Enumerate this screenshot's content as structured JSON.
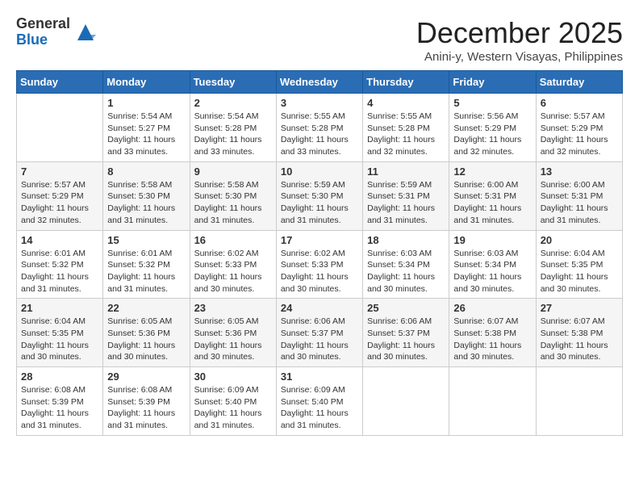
{
  "logo": {
    "general": "General",
    "blue": "Blue"
  },
  "title": "December 2025",
  "location": "Anini-y, Western Visayas, Philippines",
  "days_header": [
    "Sunday",
    "Monday",
    "Tuesday",
    "Wednesday",
    "Thursday",
    "Friday",
    "Saturday"
  ],
  "weeks": [
    [
      {
        "day": "",
        "info": ""
      },
      {
        "day": "1",
        "info": "Sunrise: 5:54 AM\nSunset: 5:27 PM\nDaylight: 11 hours and 33 minutes."
      },
      {
        "day": "2",
        "info": "Sunrise: 5:54 AM\nSunset: 5:28 PM\nDaylight: 11 hours and 33 minutes."
      },
      {
        "day": "3",
        "info": "Sunrise: 5:55 AM\nSunset: 5:28 PM\nDaylight: 11 hours and 33 minutes."
      },
      {
        "day": "4",
        "info": "Sunrise: 5:55 AM\nSunset: 5:28 PM\nDaylight: 11 hours and 32 minutes."
      },
      {
        "day": "5",
        "info": "Sunrise: 5:56 AM\nSunset: 5:29 PM\nDaylight: 11 hours and 32 minutes."
      },
      {
        "day": "6",
        "info": "Sunrise: 5:57 AM\nSunset: 5:29 PM\nDaylight: 11 hours and 32 minutes."
      }
    ],
    [
      {
        "day": "7",
        "info": "Sunrise: 5:57 AM\nSunset: 5:29 PM\nDaylight: 11 hours and 32 minutes."
      },
      {
        "day": "8",
        "info": "Sunrise: 5:58 AM\nSunset: 5:30 PM\nDaylight: 11 hours and 31 minutes."
      },
      {
        "day": "9",
        "info": "Sunrise: 5:58 AM\nSunset: 5:30 PM\nDaylight: 11 hours and 31 minutes."
      },
      {
        "day": "10",
        "info": "Sunrise: 5:59 AM\nSunset: 5:30 PM\nDaylight: 11 hours and 31 minutes."
      },
      {
        "day": "11",
        "info": "Sunrise: 5:59 AM\nSunset: 5:31 PM\nDaylight: 11 hours and 31 minutes."
      },
      {
        "day": "12",
        "info": "Sunrise: 6:00 AM\nSunset: 5:31 PM\nDaylight: 11 hours and 31 minutes."
      },
      {
        "day": "13",
        "info": "Sunrise: 6:00 AM\nSunset: 5:31 PM\nDaylight: 11 hours and 31 minutes."
      }
    ],
    [
      {
        "day": "14",
        "info": "Sunrise: 6:01 AM\nSunset: 5:32 PM\nDaylight: 11 hours and 31 minutes."
      },
      {
        "day": "15",
        "info": "Sunrise: 6:01 AM\nSunset: 5:32 PM\nDaylight: 11 hours and 31 minutes."
      },
      {
        "day": "16",
        "info": "Sunrise: 6:02 AM\nSunset: 5:33 PM\nDaylight: 11 hours and 30 minutes."
      },
      {
        "day": "17",
        "info": "Sunrise: 6:02 AM\nSunset: 5:33 PM\nDaylight: 11 hours and 30 minutes."
      },
      {
        "day": "18",
        "info": "Sunrise: 6:03 AM\nSunset: 5:34 PM\nDaylight: 11 hours and 30 minutes."
      },
      {
        "day": "19",
        "info": "Sunrise: 6:03 AM\nSunset: 5:34 PM\nDaylight: 11 hours and 30 minutes."
      },
      {
        "day": "20",
        "info": "Sunrise: 6:04 AM\nSunset: 5:35 PM\nDaylight: 11 hours and 30 minutes."
      }
    ],
    [
      {
        "day": "21",
        "info": "Sunrise: 6:04 AM\nSunset: 5:35 PM\nDaylight: 11 hours and 30 minutes."
      },
      {
        "day": "22",
        "info": "Sunrise: 6:05 AM\nSunset: 5:36 PM\nDaylight: 11 hours and 30 minutes."
      },
      {
        "day": "23",
        "info": "Sunrise: 6:05 AM\nSunset: 5:36 PM\nDaylight: 11 hours and 30 minutes."
      },
      {
        "day": "24",
        "info": "Sunrise: 6:06 AM\nSunset: 5:37 PM\nDaylight: 11 hours and 30 minutes."
      },
      {
        "day": "25",
        "info": "Sunrise: 6:06 AM\nSunset: 5:37 PM\nDaylight: 11 hours and 30 minutes."
      },
      {
        "day": "26",
        "info": "Sunrise: 6:07 AM\nSunset: 5:38 PM\nDaylight: 11 hours and 30 minutes."
      },
      {
        "day": "27",
        "info": "Sunrise: 6:07 AM\nSunset: 5:38 PM\nDaylight: 11 hours and 30 minutes."
      }
    ],
    [
      {
        "day": "28",
        "info": "Sunrise: 6:08 AM\nSunset: 5:39 PM\nDaylight: 11 hours and 31 minutes."
      },
      {
        "day": "29",
        "info": "Sunrise: 6:08 AM\nSunset: 5:39 PM\nDaylight: 11 hours and 31 minutes."
      },
      {
        "day": "30",
        "info": "Sunrise: 6:09 AM\nSunset: 5:40 PM\nDaylight: 11 hours and 31 minutes."
      },
      {
        "day": "31",
        "info": "Sunrise: 6:09 AM\nSunset: 5:40 PM\nDaylight: 11 hours and 31 minutes."
      },
      {
        "day": "",
        "info": ""
      },
      {
        "day": "",
        "info": ""
      },
      {
        "day": "",
        "info": ""
      }
    ]
  ]
}
